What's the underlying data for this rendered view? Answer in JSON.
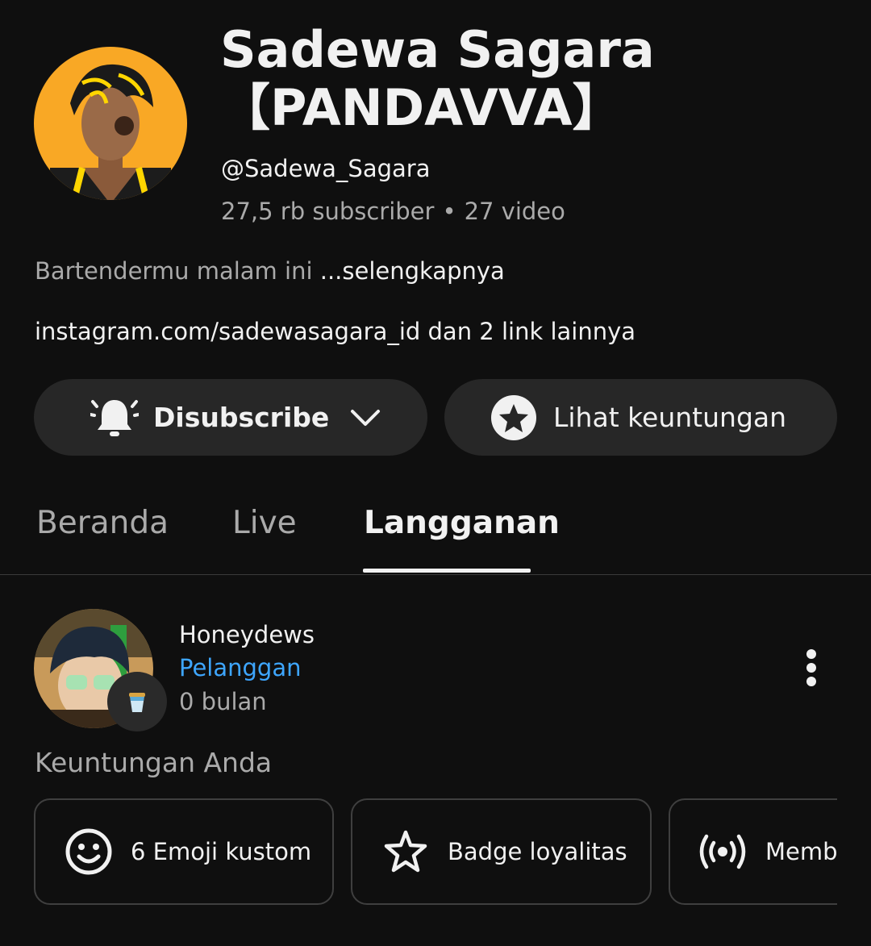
{
  "channel": {
    "name": "Sadewa Sagara 【PANDAVVA】",
    "handle": "@Sadewa_Sagara",
    "subscribers": "27,5 rb subscriber",
    "separator": "•",
    "videos": "27 video",
    "description": "Bartendermu malam ini ",
    "description_more": "...selengkapnya",
    "links": "instagram.com/sadewasagara_id dan 2 link lainnya"
  },
  "actions": {
    "subscribe_label": "Disubscribe",
    "perks_label": "Lihat keuntungan"
  },
  "tabs": [
    {
      "label": "Beranda"
    },
    {
      "label": "Live"
    },
    {
      "label": "Langganan"
    }
  ],
  "member": {
    "name": "Honeydews",
    "role": "Pelanggan",
    "duration": "0 bulan"
  },
  "perks": {
    "heading": "Keuntungan Anda",
    "items": [
      {
        "label": "6 Emoji kustom",
        "icon": "smiley-icon"
      },
      {
        "label": "Badge loyalitas",
        "icon": "star-outline-icon"
      },
      {
        "label": "Memb",
        "icon": "broadcast-icon"
      }
    ]
  },
  "colors": {
    "background": "#0f0f0f",
    "pill": "#272727",
    "link_blue": "#3ea6ff",
    "secondary_text": "#aaaaaa",
    "avatar_bg": "#f9a825"
  }
}
